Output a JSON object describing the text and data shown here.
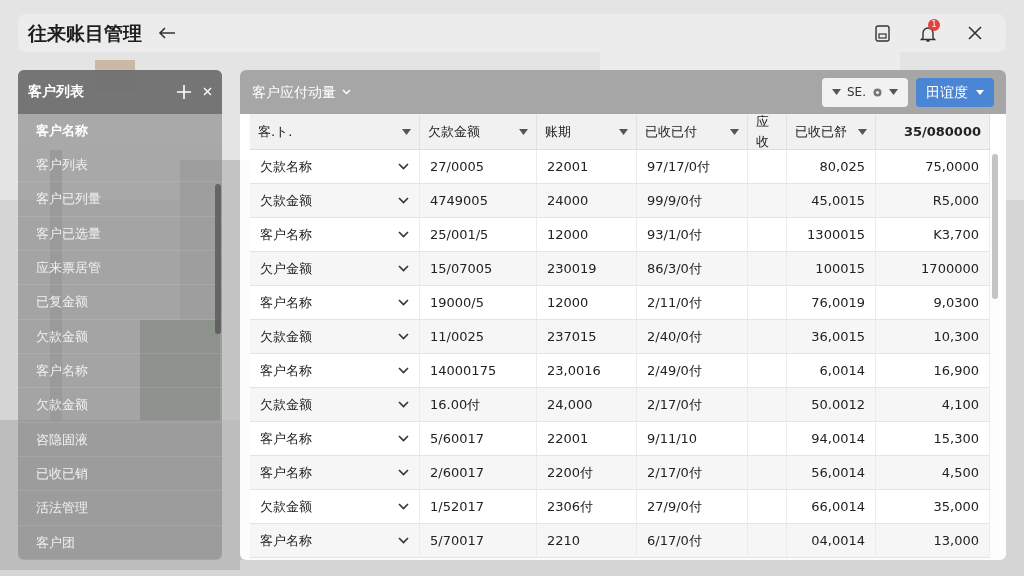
{
  "window": {
    "title": "往来账目管理"
  },
  "header": {
    "badge": "1"
  },
  "sidebar": {
    "title": "客户列表",
    "items": [
      {
        "label": "客户名称",
        "selected": true
      },
      {
        "label": "客户列表",
        "selected": false
      },
      {
        "label": "客户已列量",
        "selected": false
      },
      {
        "label": "客户已选量",
        "selected": false
      },
      {
        "label": "应来票居管",
        "selected": false
      },
      {
        "label": "已复金额",
        "selected": false
      },
      {
        "label": "欠款金额",
        "selected": false
      },
      {
        "label": "客户名称",
        "selected": false
      },
      {
        "label": "欠款金额",
        "selected": false
      },
      {
        "label": "咨隐固液",
        "selected": false
      },
      {
        "label": "已收已销",
        "selected": false
      },
      {
        "label": "活法管理",
        "selected": false
      },
      {
        "label": "客户团",
        "selected": false
      }
    ]
  },
  "panel": {
    "title": "客户应付动量",
    "filter": "SE.",
    "view_button": "田谊度"
  },
  "table": {
    "columns": [
      "客.ト.",
      "欠款金额",
      "账期",
      "已收已付",
      "应收",
      "已收已舒",
      "35/080000"
    ],
    "rows": [
      [
        "欠款名称",
        "27/0005",
        "22001",
        "97/17/0付",
        "",
        "80,025",
        "75,0000"
      ],
      [
        "欠款金额",
        "4749005",
        "24000",
        "99/9/0付",
        "",
        "45,0015",
        "R5,000"
      ],
      [
        "客户名称",
        "25/001/5",
        "12000",
        "93/1/0付",
        "",
        "1300015",
        "K3,700"
      ],
      [
        "欠户金额",
        "15/07005",
        "230019",
        "86/3/0付",
        "",
        "100015",
        "1700000"
      ],
      [
        "客户名称",
        "19000/5",
        "12000",
        "2/11/0付",
        "",
        "76,0019",
        "9,0300"
      ],
      [
        "欠款金额",
        "11/0025",
        "237015",
        "2/40/0付",
        "",
        "36,0015",
        "10,300"
      ],
      [
        "客户名称",
        "14000175",
        "23,0016",
        "2/49/0付",
        "",
        "6,0014",
        "16,900"
      ],
      [
        "欠款金额",
        "16.00付",
        "24,000",
        "2/17/0付",
        "",
        "50.0012",
        "4,100"
      ],
      [
        "客户名称",
        "5/60017",
        "22001",
        "9/11/10",
        "",
        "94,0014",
        "15,300"
      ],
      [
        "客户名称",
        "2/60017",
        "2200付",
        "2/17/0付",
        "",
        "56,0014",
        "4,500"
      ],
      [
        "欠款金额",
        "1/52017",
        "2306付",
        "27/9/0付",
        "",
        "66,0014",
        "35,000"
      ],
      [
        "客户名称",
        "5/70017",
        "2210",
        "6/17/0付",
        "",
        "04,0014",
        "13,000"
      ]
    ]
  }
}
